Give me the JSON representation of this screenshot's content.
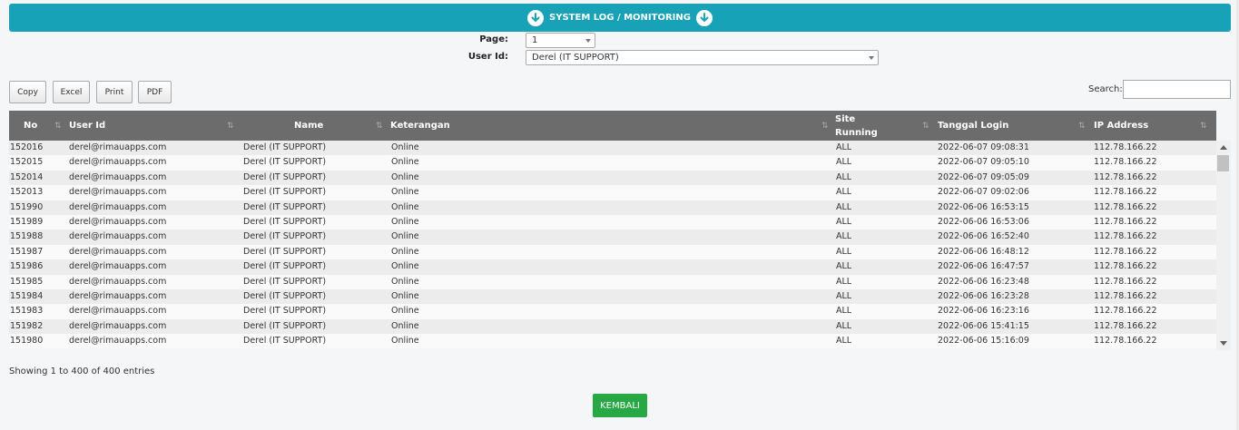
{
  "header": {
    "title": "SYSTEM LOG / MONITORING",
    "icon_left": "arrow-down-circle-icon",
    "icon_right": "arrow-down-circle-icon",
    "color": "#17a2b8"
  },
  "filters": {
    "page_label": "Page:",
    "page_value": "1",
    "user_label": "User Id:",
    "user_value": "Derel (IT SUPPORT)"
  },
  "toolbar": {
    "copy": "Copy",
    "excel": "Excel",
    "print": "Print",
    "pdf": "PDF",
    "search_label": "Search:",
    "search_value": ""
  },
  "table": {
    "columns": [
      "No",
      "User Id",
      "Name",
      "Keterangan",
      "Site Running",
      "Tanggal Login",
      "IP Address"
    ],
    "site_running_line1": "Site",
    "site_running_line2": "Running",
    "rows": [
      [
        "152016",
        "derel@rimauapps.com",
        "Derel (IT SUPPORT)",
        "Online",
        "ALL",
        "2022-06-07 09:08:31",
        "112.78.166.22"
      ],
      [
        "152015",
        "derel@rimauapps.com",
        "Derel (IT SUPPORT)",
        "Online",
        "ALL",
        "2022-06-07 09:05:10",
        "112.78.166.22"
      ],
      [
        "152014",
        "derel@rimauapps.com",
        "Derel (IT SUPPORT)",
        "Online",
        "ALL",
        "2022-06-07 09:05:09",
        "112.78.166.22"
      ],
      [
        "152013",
        "derel@rimauapps.com",
        "Derel (IT SUPPORT)",
        "Online",
        "ALL",
        "2022-06-07 09:02:06",
        "112.78.166.22"
      ],
      [
        "151990",
        "derel@rimauapps.com",
        "Derel (IT SUPPORT)",
        "Online",
        "ALL",
        "2022-06-06 16:53:15",
        "112.78.166.22"
      ],
      [
        "151989",
        "derel@rimauapps.com",
        "Derel (IT SUPPORT)",
        "Online",
        "ALL",
        "2022-06-06 16:53:06",
        "112.78.166.22"
      ],
      [
        "151988",
        "derel@rimauapps.com",
        "Derel (IT SUPPORT)",
        "Online",
        "ALL",
        "2022-06-06 16:52:40",
        "112.78.166.22"
      ],
      [
        "151987",
        "derel@rimauapps.com",
        "Derel (IT SUPPORT)",
        "Online",
        "ALL",
        "2022-06-06 16:48:12",
        "112.78.166.22"
      ],
      [
        "151986",
        "derel@rimauapps.com",
        "Derel (IT SUPPORT)",
        "Online",
        "ALL",
        "2022-06-06 16:47:57",
        "112.78.166.22"
      ],
      [
        "151985",
        "derel@rimauapps.com",
        "Derel (IT SUPPORT)",
        "Online",
        "ALL",
        "2022-06-06 16:23:48",
        "112.78.166.22"
      ],
      [
        "151984",
        "derel@rimauapps.com",
        "Derel (IT SUPPORT)",
        "Online",
        "ALL",
        "2022-06-06 16:23:28",
        "112.78.166.22"
      ],
      [
        "151983",
        "derel@rimauapps.com",
        "Derel (IT SUPPORT)",
        "Online",
        "ALL",
        "2022-06-06 16:23:16",
        "112.78.166.22"
      ],
      [
        "151982",
        "derel@rimauapps.com",
        "Derel (IT SUPPORT)",
        "Online",
        "ALL",
        "2022-06-06 15:41:15",
        "112.78.166.22"
      ],
      [
        "151980",
        "derel@rimauapps.com",
        "Derel (IT SUPPORT)",
        "Online",
        "ALL",
        "2022-06-06 15:16:09",
        "112.78.166.22"
      ]
    ]
  },
  "footer": {
    "info": "Showing 1 to 400 of 400 entries",
    "back_button": "KEMBALI",
    "back_color": "#28a745"
  }
}
